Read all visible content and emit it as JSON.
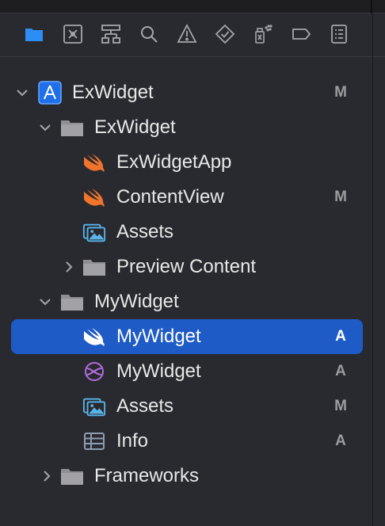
{
  "toolbar": {
    "icons": [
      "folder-icon",
      "source-control-icon",
      "hierarchy-icon",
      "search-icon",
      "warning-icon",
      "test-icon",
      "debug-icon",
      "breakpoint-icon",
      "report-icon"
    ],
    "active_color": "#2e8df5",
    "inactive_color": "#a6a6aa"
  },
  "tree": [
    {
      "label": "ExWidget",
      "badge": "M",
      "icon": "xcode-project-icon"
    },
    {
      "label": "ExWidget",
      "badge": "",
      "icon": "folder-icon",
      "expanded": true
    },
    {
      "label": "ExWidgetApp",
      "badge": "",
      "icon": "swift-icon"
    },
    {
      "label": "ContentView",
      "badge": "M",
      "icon": "swift-icon"
    },
    {
      "label": "Assets",
      "badge": "",
      "icon": "assets-icon"
    },
    {
      "label": "Preview Content",
      "badge": "",
      "icon": "folder-icon",
      "expanded": false
    },
    {
      "label": "MyWidget",
      "badge": "",
      "icon": "folder-icon",
      "expanded": true
    },
    {
      "label": "MyWidget",
      "badge": "A",
      "icon": "swift-icon",
      "selected": true
    },
    {
      "label": "MyWidget",
      "badge": "A",
      "icon": "intent-definition-icon"
    },
    {
      "label": "Assets",
      "badge": "M",
      "icon": "assets-icon"
    },
    {
      "label": "Info",
      "badge": "A",
      "icon": "plist-icon"
    },
    {
      "label": "Frameworks",
      "badge": "",
      "icon": "folder-icon",
      "expanded": false
    }
  ],
  "colors": {
    "background": "#292a2f",
    "selection": "#1e5bc6",
    "swift": "#f0742c",
    "badge": "#9c9c9f"
  }
}
